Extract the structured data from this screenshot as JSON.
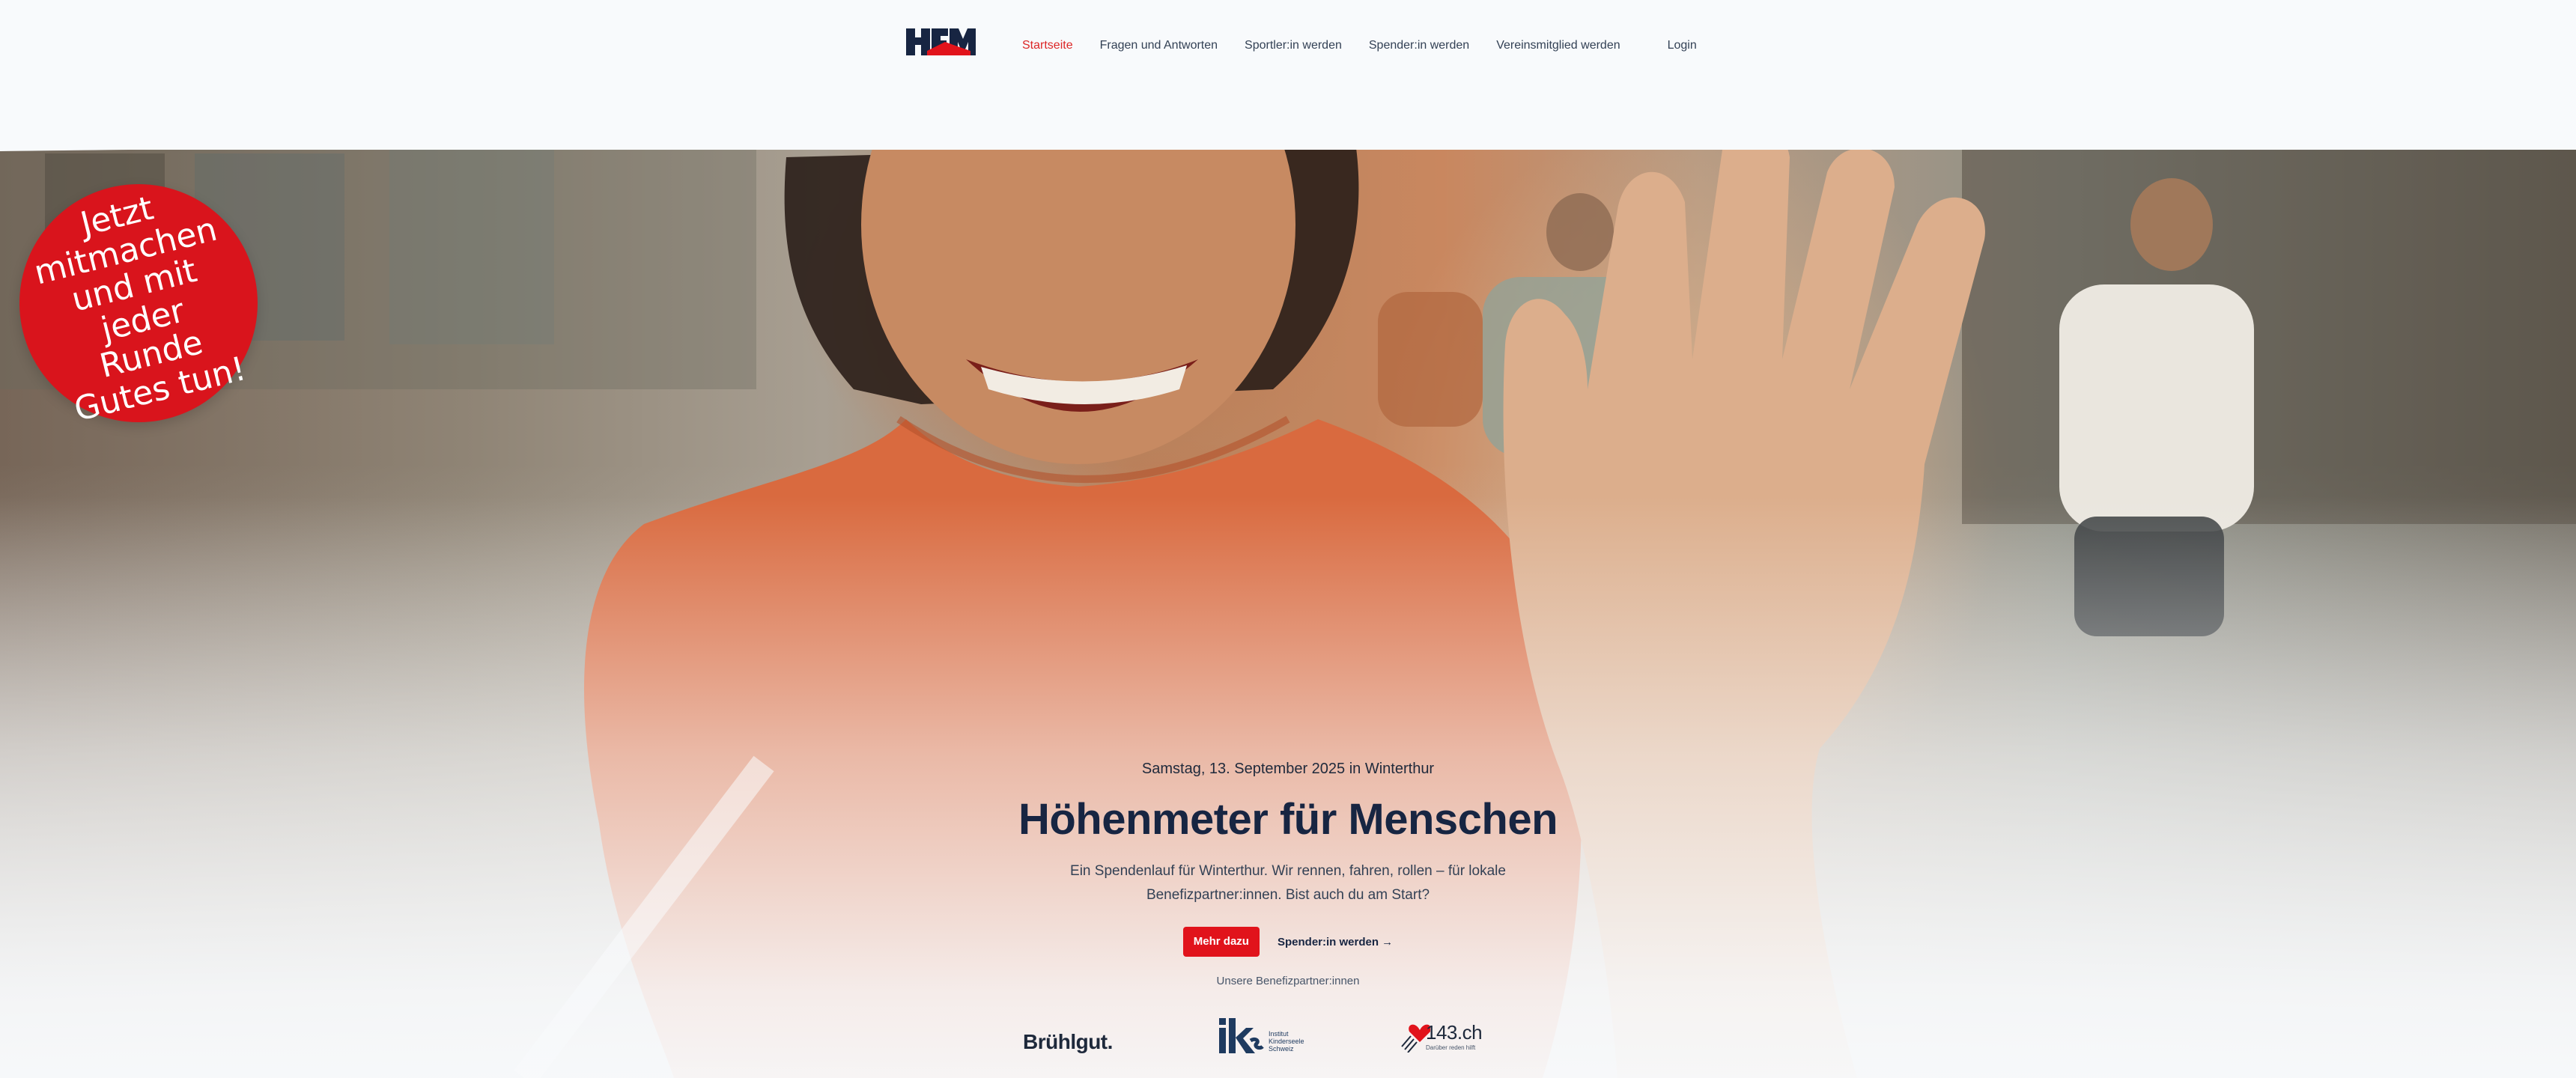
{
  "header": {
    "logo_text": "HFM",
    "nav": {
      "home": "Startseite",
      "faq": "Fragen und Antworten",
      "athlete": "Sportler:in werden",
      "donor": "Spender:in werden",
      "member": "Vereinsmitglied werden",
      "login": "Login"
    }
  },
  "sticker": {
    "text": "Jetzt mitmachen und mit jeder Runde Gutes tun!"
  },
  "hero": {
    "date": "Samstag, 13. September 2025 in Winterthur",
    "title": "Höhenmeter für Menschen",
    "description": "Ein Spendenlauf für Winterthur. Wir rennen, fahren, rollen – für lokale Benefizpartner:innen. Bist auch du am Start?",
    "primary_button": "Mehr dazu",
    "secondary_link": "Spender:in werden →"
  },
  "partners": {
    "label": "Unsere Benefizpartner:innen",
    "items": [
      {
        "name": "Brühlgut."
      },
      {
        "name": "iks",
        "subtitle": "Institut Kinderseele Schweiz"
      },
      {
        "name": "143.ch",
        "subtitle": "Darüber reden hilft"
      }
    ]
  },
  "colors": {
    "accent": "#e1131b",
    "navy": "#172542",
    "background": "#f8fafc"
  }
}
